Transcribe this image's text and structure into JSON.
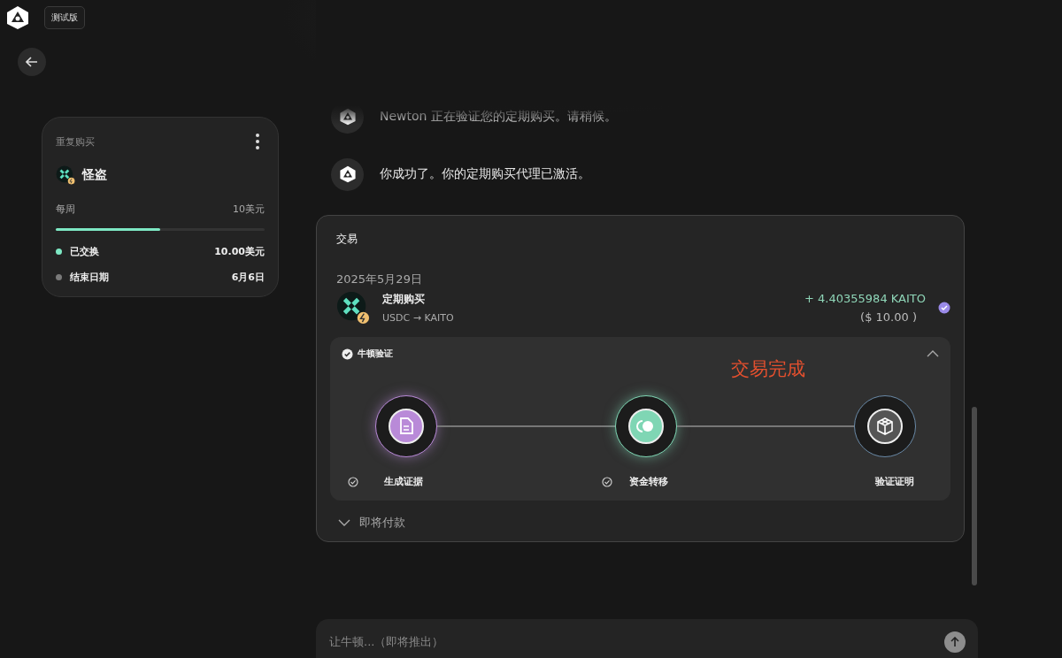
{
  "header": {
    "badge": "测试版"
  },
  "plan_card": {
    "title": "重复购买",
    "token": "怪盗",
    "frequency": "每周",
    "amount": "10美元",
    "level": 0.5,
    "stats": [
      {
        "label": "已交换",
        "value": "10.00美元",
        "color": "#7ee8c4"
      },
      {
        "label": "结束日期",
        "value": "6月6日",
        "color": "#7a7a7a"
      }
    ]
  },
  "messages": [
    "Newton 正在验证您的定期购买。请稍候。",
    "你成功了。你的定期购买代理已激活。"
  ],
  "transaction": {
    "title": "交易",
    "date": "2025年5月29日",
    "name": "定期购买",
    "pair": "USDC → KAITO",
    "amount": "+ 4.40355984 KAITO",
    "usd": "($ 10.00 )",
    "verification": {
      "title": "牛顿验证",
      "expanded": true,
      "status": "交易完成",
      "steps": [
        {
          "kind": "document",
          "label": "生成证据",
          "checked": true,
          "color": "#b98ad8"
        },
        {
          "kind": "toggle",
          "label": "资金转移",
          "checked": true,
          "color": "#7fd6b4"
        },
        {
          "kind": "cube",
          "label": "验证证明",
          "checked": false,
          "color": "#6a8aa8"
        }
      ]
    },
    "upcoming": {
      "label": "即将付款",
      "expanded": false
    }
  },
  "composer": {
    "placeholder": "让牛顿...（即将推出）"
  }
}
